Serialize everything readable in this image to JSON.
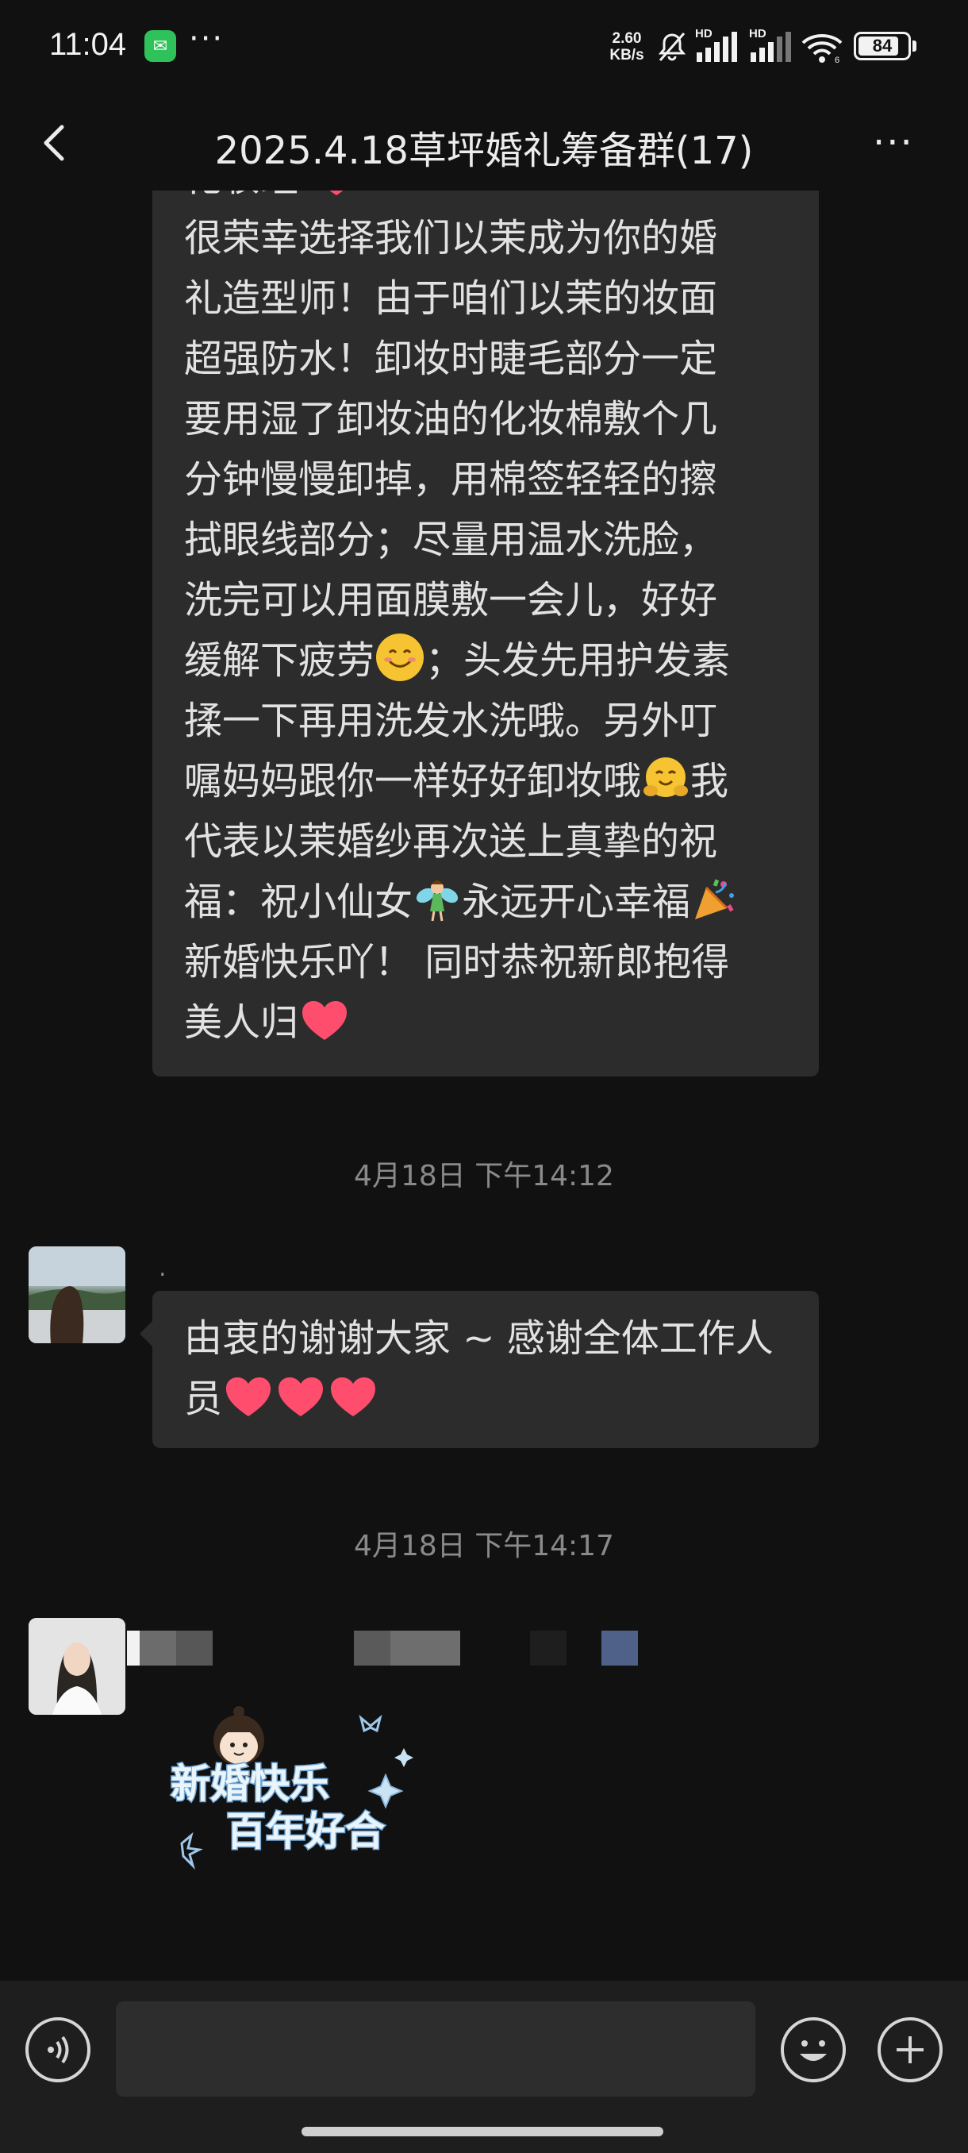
{
  "status_bar": {
    "time": "11:04",
    "more_dots": "···",
    "net_speed_value": "2.60",
    "net_speed_unit": "KB/s",
    "signal_label_1": "HD",
    "signal_label_2": "HD",
    "wifi_sub": "6",
    "battery": "84",
    "battery_level": 0.84
  },
  "nav": {
    "title": "2025.4.18草坪婚礼筹备群(17)",
    "more": "···"
  },
  "messages": [
    {
      "type": "text",
      "partial_top": "化妆组",
      "lines_before_face": "很荣幸选择我们以茉成为你的婚\n礼造型师！由于咱们以茉的妆面\n超强防水！卸妆时睫毛部分一定\n要用湿了卸妆油的化妆棉敷个几\n分钟慢慢卸掉，用棉签轻轻的擦\n拭眼线部分；尽量用温水洗脸，\n洗完可以用面膜敷一会儿，好好\n缓解下疲劳",
      "after_face": "；头发先用护发素\n揉一下再用洗发水洗哦。另外叮\n嘱妈妈跟你一样好好卸妆哦",
      "after_hug": "我\n代表以茉婚纱再次送上真挚的祝\n福：祝小仙女",
      "after_fairy": "永远开心幸福",
      "after_party": "\n新婚快乐吖！ 同时恭祝新郎抱得\n美人归"
    },
    {
      "type": "timestamp",
      "text": "4月18日 下午14:12"
    },
    {
      "type": "text",
      "sender": ".",
      "text": "由衷的谢谢大家 ~ 感谢全体工作人\n员"
    },
    {
      "type": "timestamp",
      "text": "4月18日 下午14:17"
    },
    {
      "type": "sticker",
      "line1": "新婚快乐",
      "line2": "百年好合"
    }
  ],
  "input": {
    "placeholder": ""
  },
  "colors": {
    "background": "#111111",
    "bubble": "#2c2c2c",
    "input_bar": "#1e1e1e",
    "heart": "#ff4d6d"
  }
}
